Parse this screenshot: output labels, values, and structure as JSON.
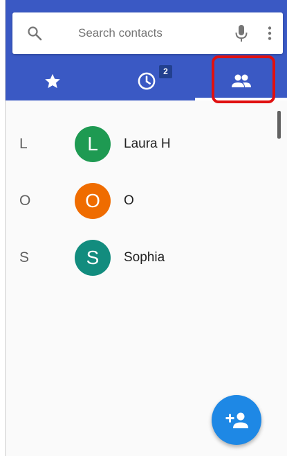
{
  "search": {
    "placeholder": "Search contacts",
    "icons": [
      "search-icon",
      "mic-icon",
      "more-vert-icon"
    ]
  },
  "tabs": [
    {
      "name": "favorites",
      "icon": "star-icon",
      "selected": false
    },
    {
      "name": "recents",
      "icon": "clock-icon",
      "badge": "2",
      "selected": false
    },
    {
      "name": "contacts",
      "icon": "people-icon",
      "selected": true
    }
  ],
  "contacts": [
    {
      "section": "L",
      "initial": "L",
      "name": "Laura H",
      "color": "#1e9a52"
    },
    {
      "section": "O",
      "initial": "O",
      "name": "O",
      "color": "#ef6c00"
    },
    {
      "section": "S",
      "initial": "S",
      "name": "Sophia",
      "color": "#128c7e"
    }
  ],
  "fab": {
    "icon": "add-person-icon",
    "color": "#1e88e5"
  },
  "colors": {
    "toolbar": "#3a59c4",
    "highlight": "#e01010",
    "badge": "#22408f"
  }
}
